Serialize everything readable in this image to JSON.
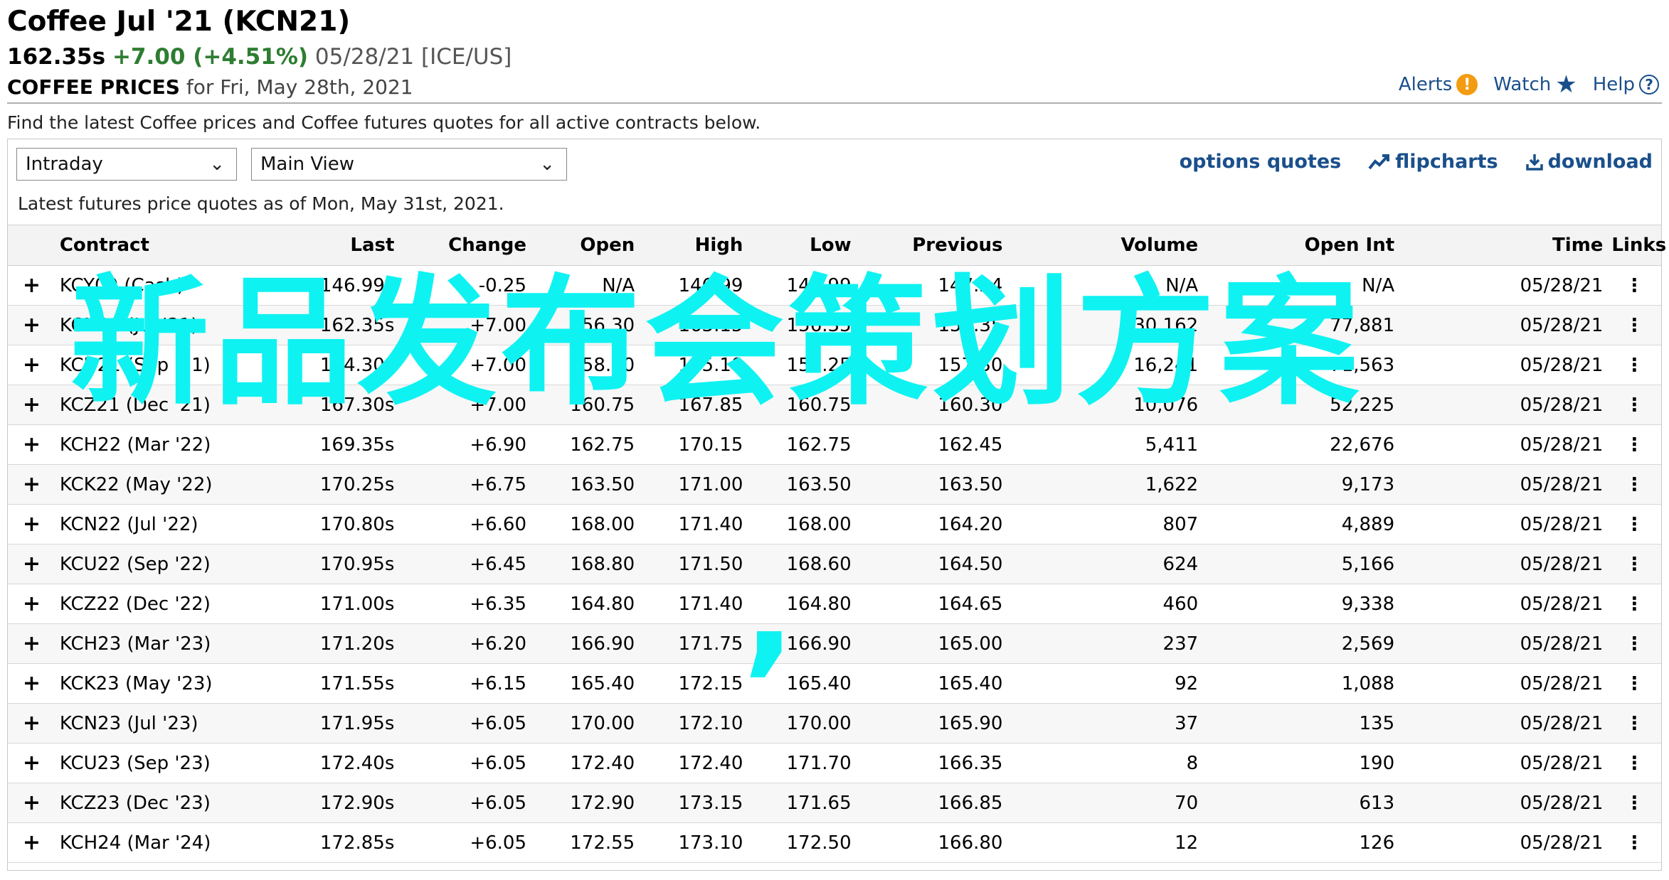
{
  "header": {
    "title": "Coffee Jul '21 (KCN21)",
    "last": "162.35s",
    "change": "+7.00 (+4.51%)",
    "meta": "05/28/21 [ICE/US]",
    "prices_label": "COFFEE PRICES",
    "prices_date": "for Fri, May 28th, 2021"
  },
  "top_links": {
    "alerts": "Alerts",
    "watch": "Watch",
    "help": "Help"
  },
  "intro": "Find the latest Coffee prices and Coffee futures quotes for all active contracts below.",
  "controls": {
    "period_select": "Intraday",
    "view_select": "Main View",
    "options_quotes": "options quotes",
    "flipcharts": "flipcharts",
    "download": "download"
  },
  "asof": "Latest futures price quotes as of Mon, May 31st, 2021.",
  "overlay": {
    "line1": "新品发布会策划方案",
    "line2": ","
  },
  "table": {
    "columns": [
      "Contract",
      "Last",
      "Change",
      "Open",
      "High",
      "Low",
      "Previous",
      "Volume",
      "Open Int",
      "Time",
      "Links"
    ],
    "rows": [
      {
        "contract": "KCY00 (Cash)",
        "last": "146.99s",
        "change": "-0.25",
        "open": "N/A",
        "high": "146.99",
        "low": "146.99",
        "previous": "147.24",
        "volume": "N/A",
        "openint": "N/A",
        "time": "05/28/21",
        "dir": "neg"
      },
      {
        "contract": "KCN21 (Jul '21)",
        "last": "162.35s",
        "change": "+7.00",
        "open": "156.30",
        "high": "163.15",
        "low": "156.35",
        "previous": "155.35",
        "volume": "30,162",
        "openint": "77,881",
        "time": "05/28/21",
        "dir": "pos"
      },
      {
        "contract": "KCU21 (Sep '21)",
        "last": "164.30s",
        "change": "+7.00",
        "open": "158.00",
        "high": "165.10",
        "low": "158.25",
        "previous": "157.30",
        "volume": "16,241",
        "openint": "71,563",
        "time": "05/28/21",
        "dir": "pos"
      },
      {
        "contract": "KCZ21 (Dec '21)",
        "last": "167.30s",
        "change": "+7.00",
        "open": "160.75",
        "high": "167.85",
        "low": "160.75",
        "previous": "160.30",
        "volume": "10,076",
        "openint": "52,225",
        "time": "05/28/21",
        "dir": "pos"
      },
      {
        "contract": "KCH22 (Mar '22)",
        "last": "169.35s",
        "change": "+6.90",
        "open": "162.75",
        "high": "170.15",
        "low": "162.75",
        "previous": "162.45",
        "volume": "5,411",
        "openint": "22,676",
        "time": "05/28/21",
        "dir": "pos"
      },
      {
        "contract": "KCK22 (May '22)",
        "last": "170.25s",
        "change": "+6.75",
        "open": "163.50",
        "high": "171.00",
        "low": "163.50",
        "previous": "163.50",
        "volume": "1,622",
        "openint": "9,173",
        "time": "05/28/21",
        "dir": "pos"
      },
      {
        "contract": "KCN22 (Jul '22)",
        "last": "170.80s",
        "change": "+6.60",
        "open": "168.00",
        "high": "171.40",
        "low": "168.00",
        "previous": "164.20",
        "volume": "807",
        "openint": "4,889",
        "time": "05/28/21",
        "dir": "pos"
      },
      {
        "contract": "KCU22 (Sep '22)",
        "last": "170.95s",
        "change": "+6.45",
        "open": "168.80",
        "high": "171.50",
        "low": "168.60",
        "previous": "164.50",
        "volume": "624",
        "openint": "5,166",
        "time": "05/28/21",
        "dir": "pos"
      },
      {
        "contract": "KCZ22 (Dec '22)",
        "last": "171.00s",
        "change": "+6.35",
        "open": "164.80",
        "high": "171.40",
        "low": "164.80",
        "previous": "164.65",
        "volume": "460",
        "openint": "9,338",
        "time": "05/28/21",
        "dir": "pos"
      },
      {
        "contract": "KCH23 (Mar '23)",
        "last": "171.20s",
        "change": "+6.20",
        "open": "166.90",
        "high": "171.75",
        "low": "166.90",
        "previous": "165.00",
        "volume": "237",
        "openint": "2,569",
        "time": "05/28/21",
        "dir": "pos"
      },
      {
        "contract": "KCK23 (May '23)",
        "last": "171.55s",
        "change": "+6.15",
        "open": "165.40",
        "high": "172.15",
        "low": "165.40",
        "previous": "165.40",
        "volume": "92",
        "openint": "1,088",
        "time": "05/28/21",
        "dir": "pos"
      },
      {
        "contract": "KCN23 (Jul '23)",
        "last": "171.95s",
        "change": "+6.05",
        "open": "170.00",
        "high": "172.10",
        "low": "170.00",
        "previous": "165.90",
        "volume": "37",
        "openint": "135",
        "time": "05/28/21",
        "dir": "pos"
      },
      {
        "contract": "KCU23 (Sep '23)",
        "last": "172.40s",
        "change": "+6.05",
        "open": "172.40",
        "high": "172.40",
        "low": "171.70",
        "previous": "166.35",
        "volume": "8",
        "openint": "190",
        "time": "05/28/21",
        "dir": "pos"
      },
      {
        "contract": "KCZ23 (Dec '23)",
        "last": "172.90s",
        "change": "+6.05",
        "open": "172.90",
        "high": "173.15",
        "low": "171.65",
        "previous": "166.85",
        "volume": "70",
        "openint": "613",
        "time": "05/28/21",
        "dir": "pos"
      },
      {
        "contract": "KCH24 (Mar '24)",
        "last": "172.85s",
        "change": "+6.05",
        "open": "172.55",
        "high": "173.10",
        "low": "172.50",
        "previous": "166.80",
        "volume": "12",
        "openint": "126",
        "time": "05/28/21",
        "dir": "pos"
      }
    ]
  }
}
